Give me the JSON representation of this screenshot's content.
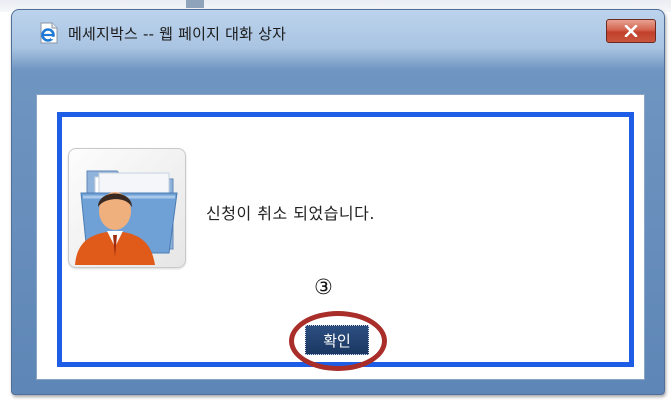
{
  "window": {
    "title": "메세지박스 -- 웹 페이지 대화 상자",
    "close_symbol": "x",
    "icon": "ie-page-icon"
  },
  "dialog": {
    "message": "신청이 취소 되었습니다.",
    "image_icon": "user-folder-icon",
    "step_marker": "③",
    "ok_label": "확인"
  },
  "colors": {
    "frame_border": "#1e5ee6",
    "highlight_ring": "#a92e2a",
    "ok_button": "#1b3762",
    "close_button": "#c1402b"
  }
}
